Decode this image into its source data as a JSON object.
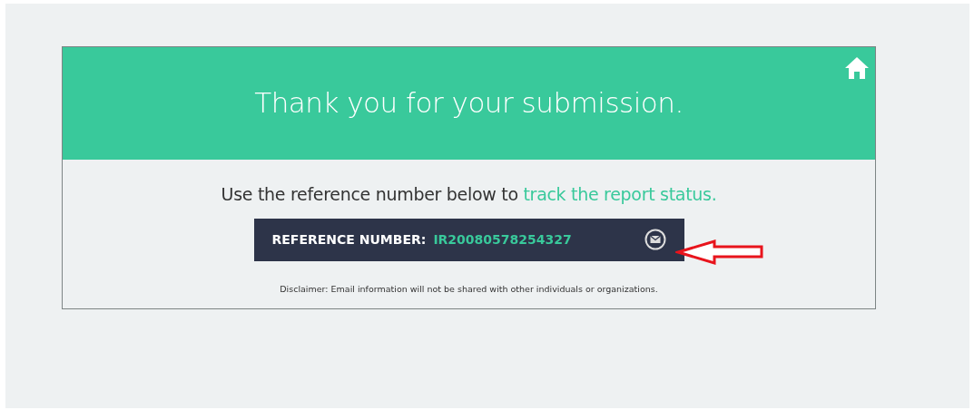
{
  "header": {
    "title": "Thank you for your submission."
  },
  "message": {
    "text": "Use the reference number below to ",
    "link": "track the report status."
  },
  "reference": {
    "label": "REFERENCE NUMBER:",
    "number": "IR20080578254327"
  },
  "disclaimer": "Disclaimer: Email information will not be shared with other individuals or organizations."
}
